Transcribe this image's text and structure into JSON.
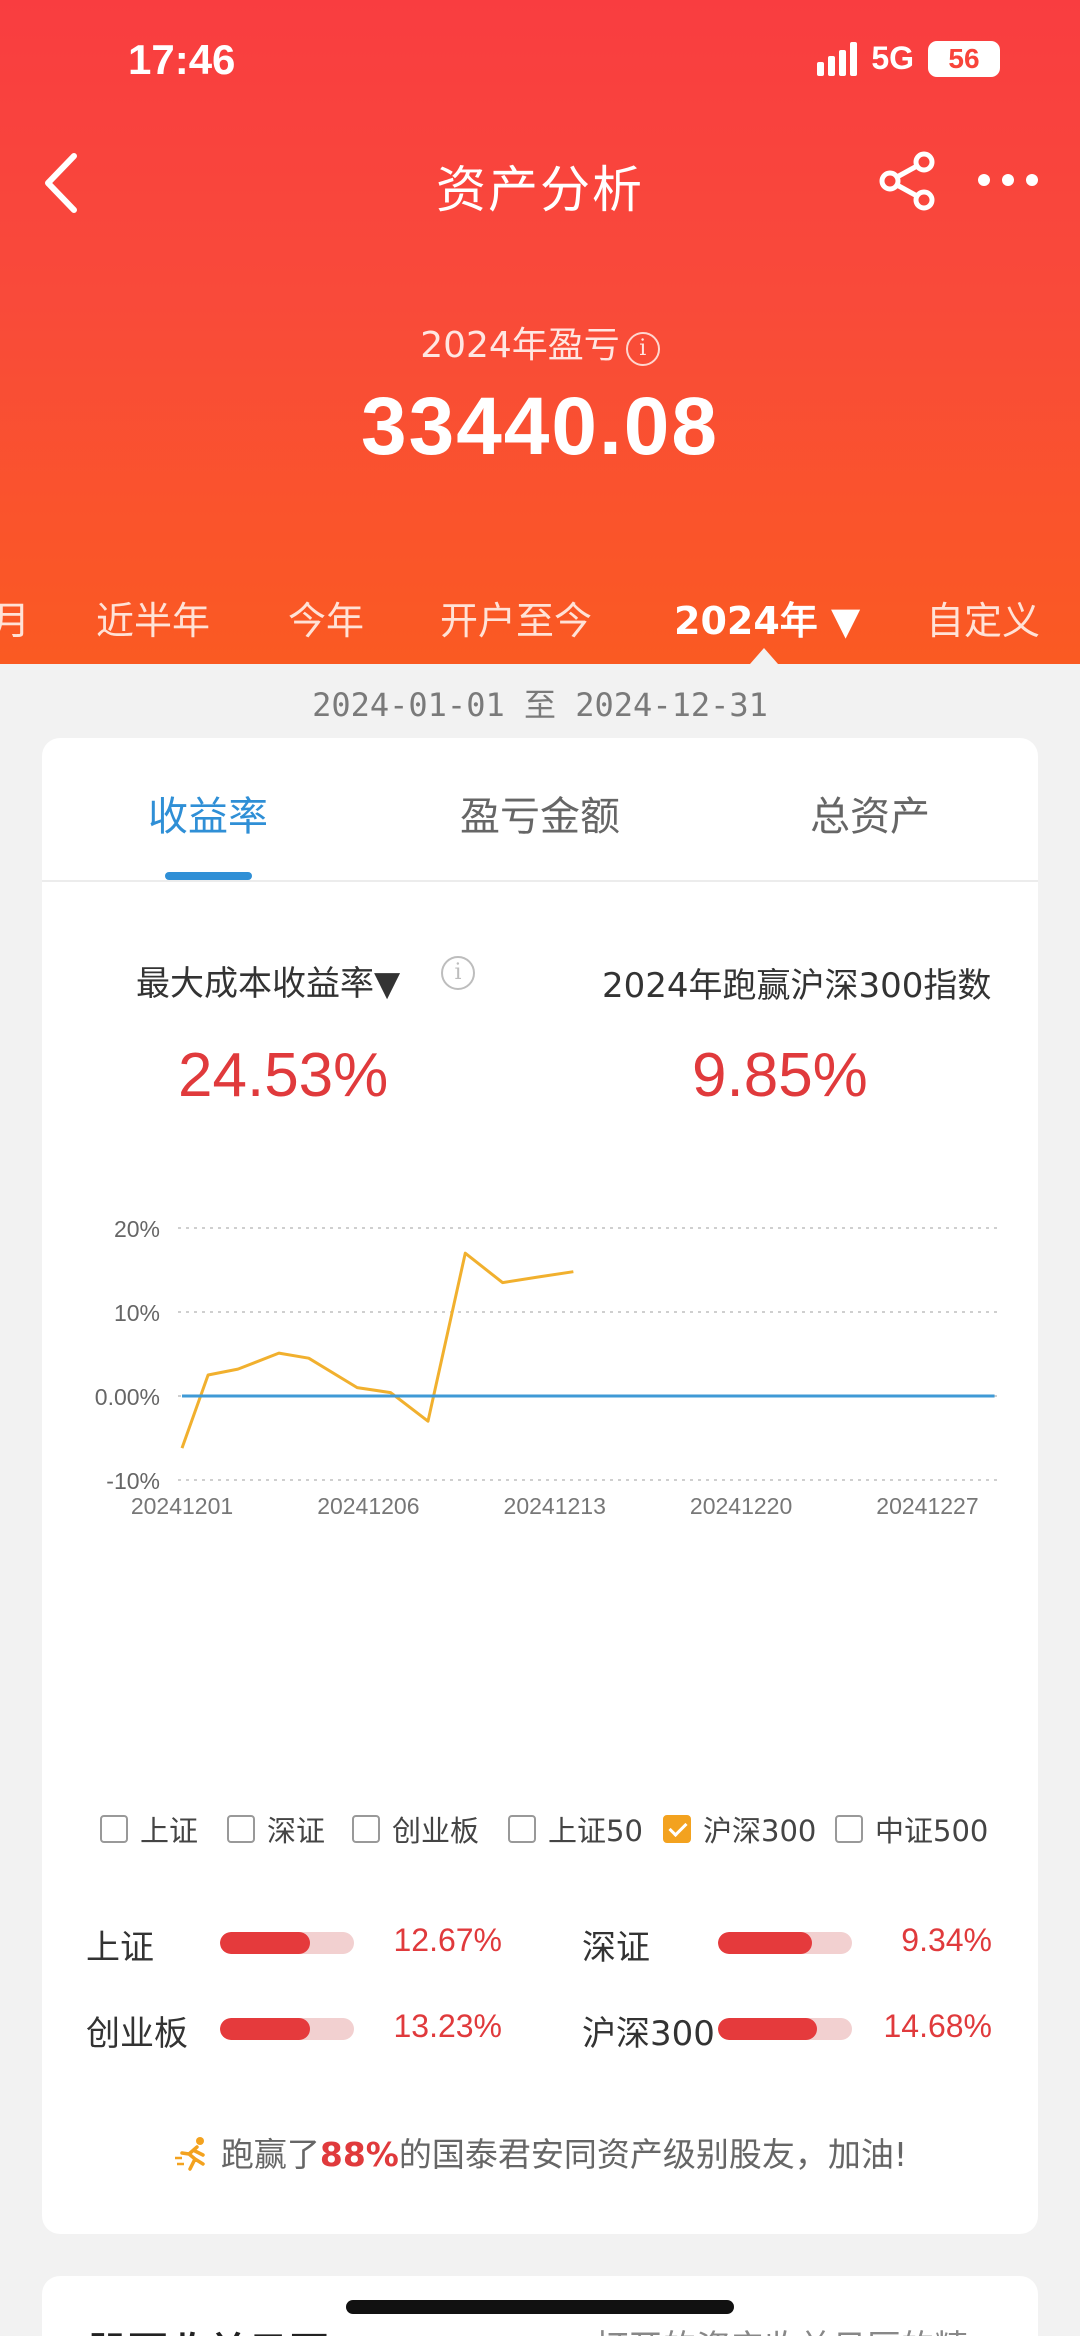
{
  "status_bar": {
    "time": "17:46",
    "network": "5G",
    "battery": "56"
  },
  "nav": {
    "title": "资产分析",
    "back_icon": "chevron-left-icon",
    "share_icon": "share-icon",
    "more_icon": "more-dots-icon"
  },
  "summary": {
    "label": "2024年盈亏",
    "info_icon": "info-icon",
    "value": "33440.08"
  },
  "range_tabs": [
    {
      "label": "月",
      "active": false
    },
    {
      "label": "近半年",
      "active": false
    },
    {
      "label": "今年",
      "active": false
    },
    {
      "label": "开户至今",
      "active": false
    },
    {
      "label": "2024年 ▼",
      "active": true
    },
    {
      "label": "自定义",
      "active": false
    }
  ],
  "date_range": "2024-01-01 至 2024-12-31",
  "tabs": [
    {
      "label": "收益率",
      "active": true
    },
    {
      "label": "盈亏金额",
      "active": false
    },
    {
      "label": "总资产",
      "active": false
    }
  ],
  "metrics": {
    "left_label": "最大成本收益率▼",
    "left_value": "24.53%",
    "right_label": "2024年跑赢沪深300指数",
    "right_value": "9.85%"
  },
  "chart_data": {
    "type": "line",
    "y_ticks": [
      "20%",
      "10%",
      "0.00%",
      "-10%"
    ],
    "y_tick_values": [
      20,
      10,
      0,
      -10
    ],
    "ylim": [
      -10,
      20
    ],
    "x_ticks": [
      "20241201",
      "20241206",
      "20241213",
      "20241220",
      "20241227"
    ],
    "x_tick_index": [
      0,
      5,
      10,
      15,
      20
    ],
    "x_range": [
      0,
      22
    ],
    "grid": true,
    "series": [
      {
        "color": "#f1b02e",
        "x": [
          0,
          0.7,
          1.5,
          2.6,
          3.4,
          4.7,
          5.6,
          6.6,
          7.6,
          8.6,
          9.6,
          10.5
        ],
        "values": [
          -6.2,
          2.5,
          3.2,
          5.1,
          4.5,
          1.0,
          0.4,
          -3.0,
          17.0,
          13.5,
          14.2,
          14.8
        ]
      },
      {
        "color": "#3f9ad6",
        "x": [
          0,
          21.8
        ],
        "values": [
          0,
          0
        ]
      }
    ]
  },
  "legend": [
    {
      "label": "上证",
      "checked": false
    },
    {
      "label": "深证",
      "checked": false
    },
    {
      "label": "创业板",
      "checked": false
    },
    {
      "label": "上证50",
      "checked": false
    },
    {
      "label": "沪深300",
      "checked": true
    },
    {
      "label": "中证500",
      "checked": false
    }
  ],
  "comparisons": [
    {
      "label": "上证",
      "value": "12.67%",
      "fill": 0.67
    },
    {
      "label": "深证",
      "value": "9.34%",
      "fill": 0.7
    },
    {
      "label": "创业板",
      "value": "13.23%",
      "fill": 0.67
    },
    {
      "label": "沪深300",
      "value": "14.68%",
      "fill": 0.74
    }
  ],
  "footnote": {
    "prefix": "跑赢了",
    "highlight": "88%",
    "suffix": "的国泰君安同资产级别股友，加油!"
  },
  "next_card": {
    "title": "股票收益日历",
    "right_text": "...打开的资产收益日历的精..."
  }
}
